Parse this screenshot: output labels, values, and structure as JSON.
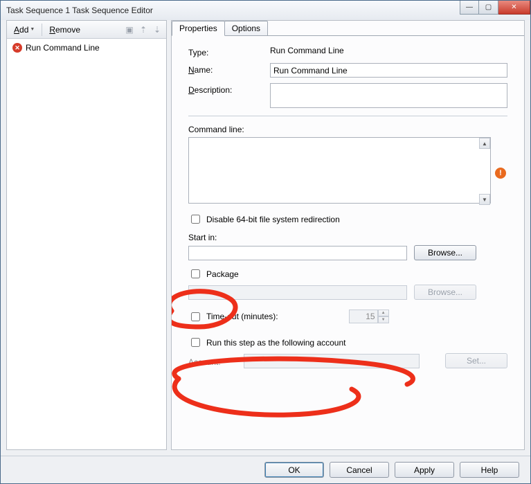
{
  "window": {
    "title": "Task Sequence 1 Task Sequence Editor"
  },
  "toolbar": {
    "add": "Add",
    "remove": "Remove"
  },
  "tree": {
    "items": [
      {
        "label": "Run Command Line",
        "error": true
      }
    ]
  },
  "tabs": {
    "properties": "Properties",
    "options": "Options"
  },
  "form": {
    "type_label": "Type:",
    "type_value": "Run Command Line",
    "name_label_pre": "",
    "name_u": "N",
    "name_label_post": "ame:",
    "name_value": "Run Command Line",
    "desc_label_pre": "",
    "desc_u": "D",
    "desc_label_post": "escription:",
    "desc_value": "",
    "cmd_label": "Command line:",
    "cmd_value": "",
    "disable64_label": "Disable 64-bit file system redirection",
    "startin_label_pre": "",
    "startin_u": "S",
    "startin_label_post": "tart in:",
    "startin_value": "",
    "browse1": "Browse...",
    "package_pre": "",
    "package_u": "P",
    "package_post": "ackage",
    "package_value": "",
    "browse2": "Browse...",
    "timeout_label": "Time-out (minutes):",
    "timeout_value": "15",
    "runas_pre": "Run this step as the follo",
    "runas_u": "w",
    "runas_post": "ing account",
    "account_label": "Account:",
    "account_value": "",
    "set_btn": "Set..."
  },
  "footer": {
    "ok": "OK",
    "cancel": "Cancel",
    "apply": "Apply",
    "help": "Help"
  }
}
